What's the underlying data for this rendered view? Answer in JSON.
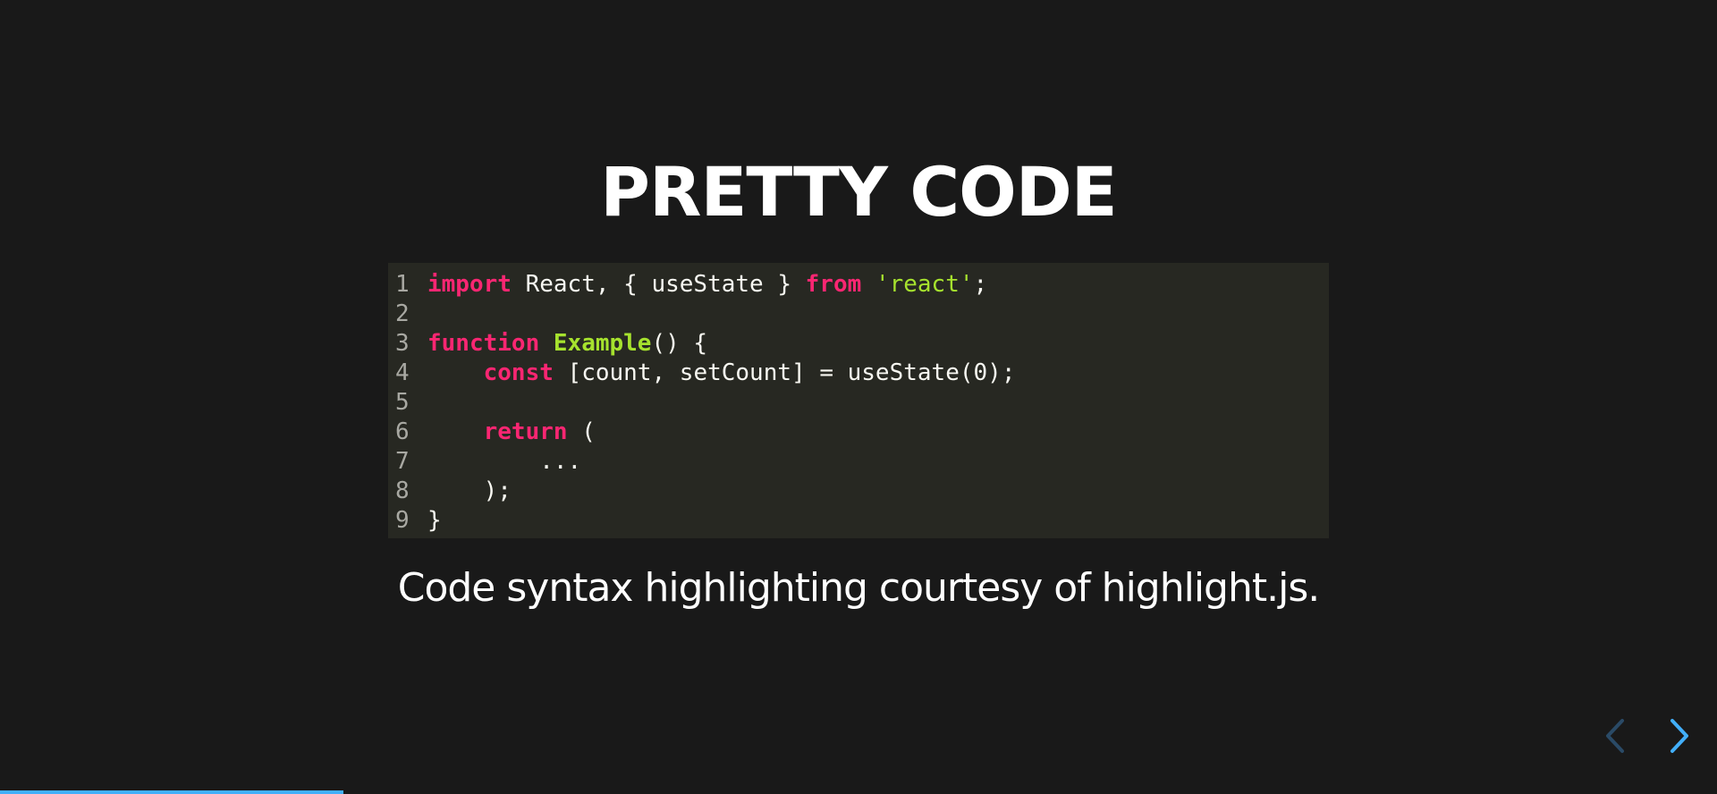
{
  "slide": {
    "title": "PRETTY CODE",
    "caption": "Code syntax highlighting courtesy of highlight.js."
  },
  "code": {
    "lines": [
      {
        "number": "1",
        "tokens": [
          {
            "type": "keyword",
            "text": "import"
          },
          {
            "type": "plain",
            "text": " React, { useState } "
          },
          {
            "type": "keyword",
            "text": "from"
          },
          {
            "type": "plain",
            "text": " "
          },
          {
            "type": "string",
            "text": "'react'"
          },
          {
            "type": "plain",
            "text": ";"
          }
        ]
      },
      {
        "number": "2",
        "tokens": []
      },
      {
        "number": "3",
        "tokens": [
          {
            "type": "keyword",
            "text": "function"
          },
          {
            "type": "plain",
            "text": " "
          },
          {
            "type": "func",
            "text": "Example"
          },
          {
            "type": "plain",
            "text": "() {"
          }
        ]
      },
      {
        "number": "4",
        "tokens": [
          {
            "type": "plain",
            "text": "    "
          },
          {
            "type": "keyword",
            "text": "const"
          },
          {
            "type": "plain",
            "text": " [count, setCount] = useState(0);"
          }
        ]
      },
      {
        "number": "5",
        "tokens": []
      },
      {
        "number": "6",
        "tokens": [
          {
            "type": "plain",
            "text": "    "
          },
          {
            "type": "keyword",
            "text": "return"
          },
          {
            "type": "plain",
            "text": " ("
          }
        ]
      },
      {
        "number": "7",
        "tokens": [
          {
            "type": "plain",
            "text": "        ..."
          }
        ]
      },
      {
        "number": "8",
        "tokens": [
          {
            "type": "plain",
            "text": "    );"
          }
        ]
      },
      {
        "number": "9",
        "tokens": [
          {
            "type": "plain",
            "text": "}"
          }
        ]
      }
    ]
  },
  "navigation": {
    "prev_icon": "chevron-left-icon",
    "next_icon": "chevron-right-icon",
    "prev_color": "#2a4a66",
    "next_color": "#42affa"
  },
  "progress": {
    "fraction": 0.2,
    "color": "#42affa"
  },
  "colors": {
    "background": "#191919",
    "code_background": "#272822",
    "keyword": "#f92672",
    "function_name": "#a6e22e",
    "string": "#a6e22e"
  }
}
